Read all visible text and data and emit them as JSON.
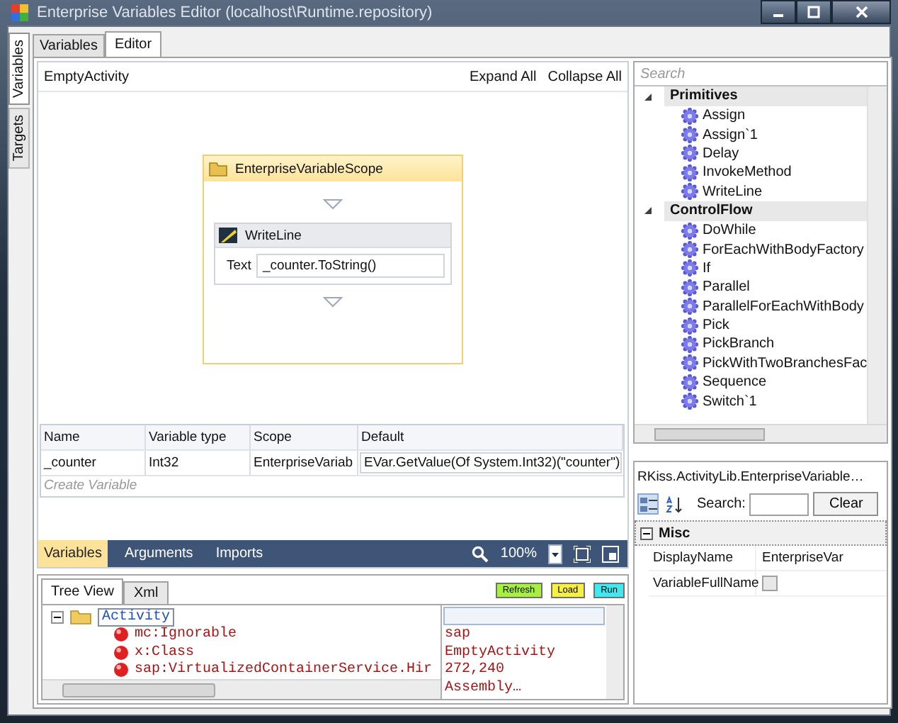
{
  "window": {
    "title": "Enterprise Variables Editor (localhost\\Runtime.repository)"
  },
  "side_tabs": [
    {
      "label": "Variables",
      "selected": true
    },
    {
      "label": "Targets",
      "selected": false
    }
  ],
  "tabs": [
    {
      "label": "Variables",
      "selected": false
    },
    {
      "label": "Editor",
      "selected": true
    }
  ],
  "designer": {
    "breadcrumb": "EmptyActivity",
    "actions": [
      "Expand All",
      "Collapse All"
    ],
    "scope": {
      "title": "EnterpriseVariableScope"
    },
    "activity": {
      "title": "WriteLine",
      "field_label": "Text",
      "field_value": "_counter.ToString()"
    },
    "variables_table": {
      "columns": [
        "Name",
        "Variable type",
        "Scope",
        "Default"
      ],
      "rows": [
        [
          "_counter",
          "Int32",
          "EnterpriseVariab",
          "EVar.GetValue(Of System.Int32)(\"counter\")"
        ]
      ],
      "placeholder": "Create Variable"
    },
    "bottom_bar": {
      "tabs": [
        {
          "label": "Variables",
          "selected": true
        },
        {
          "label": "Arguments",
          "selected": false
        },
        {
          "label": "Imports",
          "selected": false
        }
      ],
      "zoom": "100%"
    }
  },
  "toolbox": {
    "search": {
      "placeholder": "Search"
    },
    "groups": [
      {
        "name": "Primitives",
        "expanded": true,
        "items": [
          "Assign",
          "Assign`1",
          "Delay",
          "InvokeMethod",
          "WriteLine"
        ]
      },
      {
        "name": "ControlFlow",
        "expanded": true,
        "items": [
          "DoWhile",
          "ForEachWithBodyFactory",
          "If",
          "Parallel",
          "ParallelForEachWithBody",
          "Pick",
          "PickBranch",
          "PickWithTwoBranchesFac",
          "Sequence",
          "Switch`1"
        ]
      }
    ]
  },
  "properties": {
    "title": "RKiss.ActivityLib.EnterpriseVariable…",
    "search_label": "Search:",
    "clear": "Clear",
    "category": {
      "name": "Misc",
      "expanded": true
    },
    "rows": [
      {
        "kind": "text",
        "name": "DisplayName",
        "value": "EnterpriseVar"
      },
      {
        "kind": "checkbox",
        "name": "VariableFullName",
        "checked": false
      }
    ]
  },
  "xml_panel": {
    "tabs": [
      {
        "label": "Tree View",
        "selected": true
      },
      {
        "label": "Xml",
        "selected": false
      }
    ],
    "buttons": [
      {
        "label": "Refresh",
        "color": "#a8f040"
      },
      {
        "label": "Load",
        "color": "#f8f040"
      },
      {
        "label": "Run",
        "color": "#40e8f0"
      }
    ],
    "tree": {
      "label": "Activity",
      "expanded": true,
      "children": [
        {
          "label": "mc:Ignorable"
        },
        {
          "label": "x:Class"
        },
        {
          "label": "sap:VirtualizedContainerService.Hir"
        }
      ]
    },
    "values": [
      "sap",
      "EmptyActivity",
      "272,240",
      "Assembly…"
    ]
  }
}
